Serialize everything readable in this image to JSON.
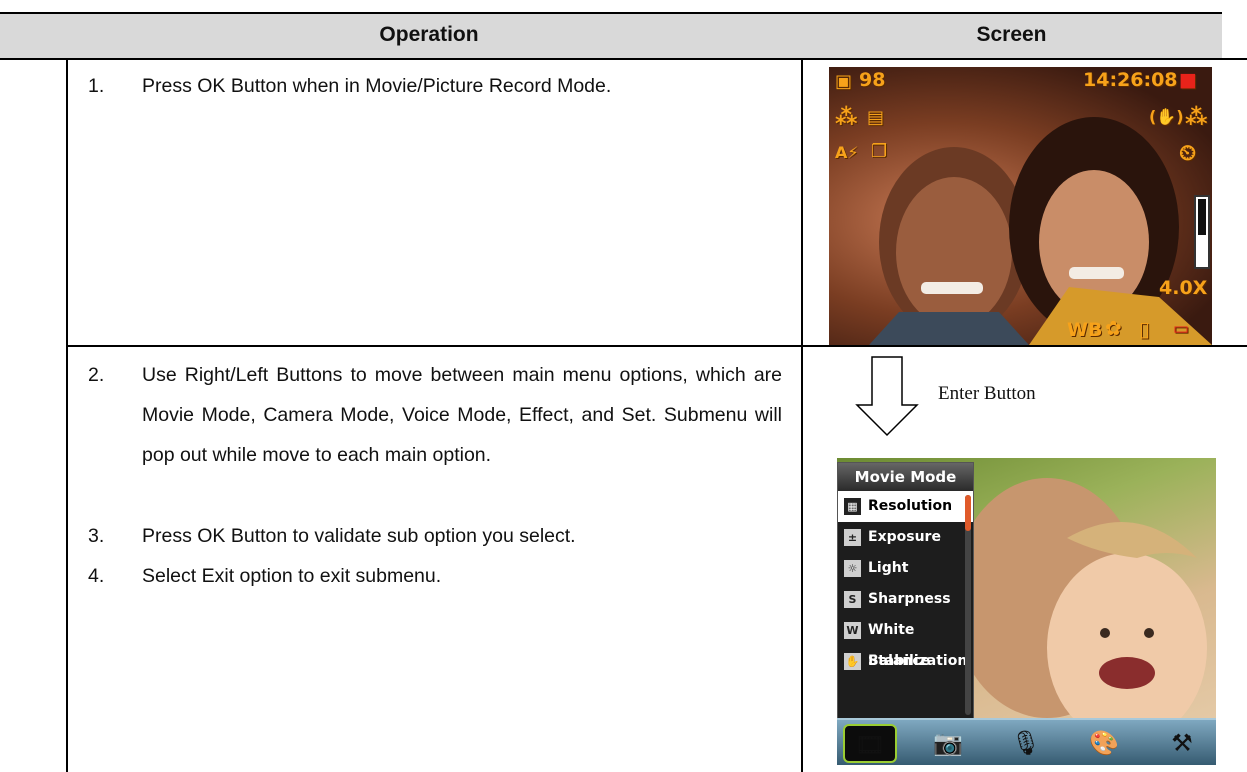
{
  "table": {
    "col_operation": "Operation",
    "col_screen": "Screen"
  },
  "rows": [
    {
      "num": "1.",
      "text": "Press OK Button when in Movie/Picture Record Mode."
    },
    {
      "num": "2.",
      "text": "Use Right/Left Buttons to move between main menu options, which are Movie Mode, Camera Mode, Voice Mode, Effect, and Set. Submenu will pop out while move to each main option."
    },
    {
      "num": "3.",
      "text": "Press OK Button to validate sub option you select."
    },
    {
      "num": "4.",
      "text": "Select Exit option to exit submenu."
    }
  ],
  "screen1": {
    "count": "98",
    "time": "14:26:08",
    "zoom": "4.0X",
    "wb": "WB",
    "osd_color": "#f7a21a"
  },
  "arrow_label": "Enter Button",
  "screen2": {
    "menu_title": "Movie Mode",
    "items": [
      {
        "label": "Resolution",
        "icon": "resolution-icon",
        "glyph": "▦"
      },
      {
        "label": "Exposure",
        "icon": "exposure-icon",
        "glyph": "±"
      },
      {
        "label": "Light",
        "icon": "light-icon",
        "glyph": "☼"
      },
      {
        "label": "Sharpness",
        "icon": "sharpness-icon",
        "glyph": "S"
      },
      {
        "label": "White Balance",
        "icon": "white-balance-icon",
        "glyph": "W"
      },
      {
        "label": "Stabilization",
        "icon": "stabilization-icon",
        "glyph": "✋"
      }
    ],
    "selected_index": 0,
    "tabs": [
      "movie-mode-icon",
      "camera-mode-icon",
      "voice-mode-icon",
      "effect-icon",
      "set-icon"
    ]
  }
}
